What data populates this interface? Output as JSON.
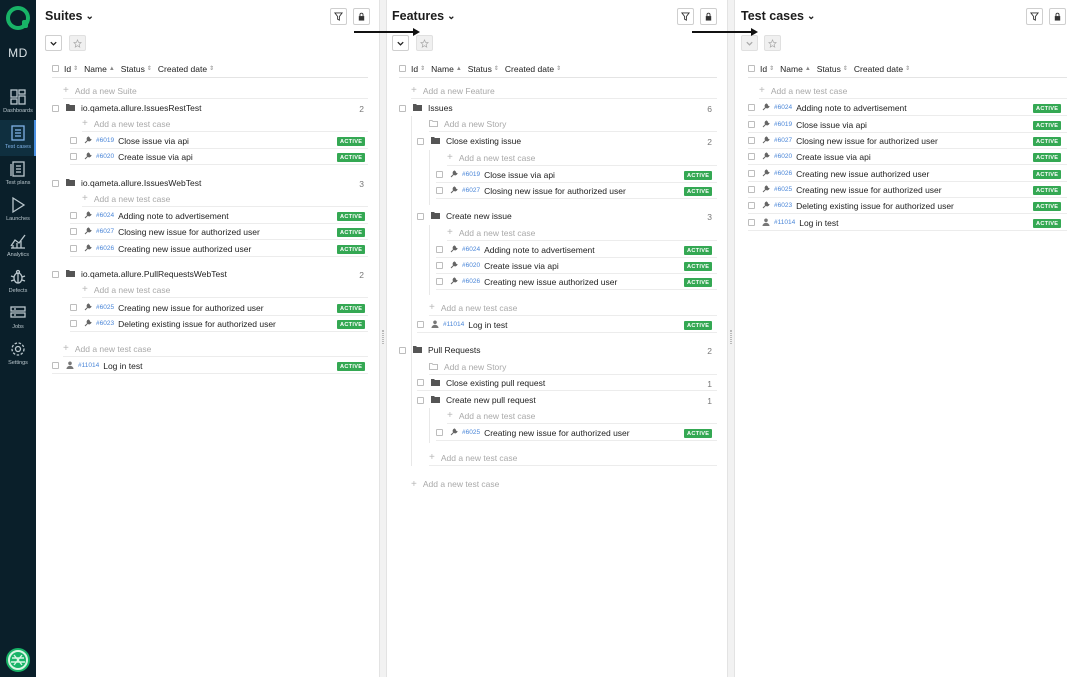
{
  "sidebar": {
    "user_initials": "MD",
    "items": [
      {
        "label": "Dashboards",
        "icon": "dashboard-icon"
      },
      {
        "label": "Test cases",
        "icon": "test-cases-icon"
      },
      {
        "label": "Test plans",
        "icon": "test-plans-icon"
      },
      {
        "label": "Launches",
        "icon": "launches-icon"
      },
      {
        "label": "Analytics",
        "icon": "analytics-icon"
      },
      {
        "label": "Defects",
        "icon": "defects-icon"
      },
      {
        "label": "Jobs",
        "icon": "jobs-icon"
      },
      {
        "label": "Settings",
        "icon": "settings-icon"
      }
    ]
  },
  "columns": {
    "id": "Id",
    "name": "Name",
    "status": "Status",
    "created": "Created date"
  },
  "status_active": "ACTIVE",
  "colors": {
    "sidebar_bg": "#0a1f2a",
    "accent": "#18b367",
    "badge": "#34a853",
    "link": "#4a86d8"
  },
  "suites": {
    "title": "Suites",
    "add_suite": "Add a new Suite",
    "add_test_case": "Add a new test case",
    "groups": [
      {
        "name": "io.qameta.allure.IssuesRestTest",
        "count": "2",
        "cases": [
          {
            "id": "#6019",
            "name": "Close issue via api"
          },
          {
            "id": "#6020",
            "name": "Create issue via api"
          }
        ]
      },
      {
        "name": "io.qameta.allure.IssuesWebTest",
        "count": "3",
        "cases": [
          {
            "id": "#6024",
            "name": "Adding note to advertisement"
          },
          {
            "id": "#6027",
            "name": "Closing new issue for authorized user"
          },
          {
            "id": "#6026",
            "name": "Creating new issue authorized user"
          }
        ]
      },
      {
        "name": "io.qameta.allure.PullRequestsWebTest",
        "count": "2",
        "cases": [
          {
            "id": "#6025",
            "name": "Creating new issue for authorized user"
          },
          {
            "id": "#6023",
            "name": "Deleting existing issue for authorized user"
          }
        ]
      }
    ],
    "bottom_add": "Add a new test case",
    "loose_case": {
      "id": "#11014",
      "name": "Log in test"
    }
  },
  "features": {
    "title": "Features",
    "add_feature": "Add a new Feature",
    "add_story": "Add a new Story",
    "add_test_case": "Add a new test case",
    "issues": {
      "name": "Issues",
      "count": "6"
    },
    "close_existing_issue": {
      "name": "Close existing issue",
      "count": "2",
      "cases": [
        {
          "id": "#6019",
          "name": "Close issue via api"
        },
        {
          "id": "#6027",
          "name": "Closing new issue for authorized user"
        }
      ]
    },
    "create_new_issue": {
      "name": "Create new issue",
      "count": "3",
      "cases": [
        {
          "id": "#6024",
          "name": "Adding note to advertisement"
        },
        {
          "id": "#6020",
          "name": "Create issue via api"
        },
        {
          "id": "#6026",
          "name": "Creating new issue authorized user"
        }
      ]
    },
    "issues_loose_case": {
      "id": "#11014",
      "name": "Log in test"
    },
    "pull_requests": {
      "name": "Pull Requests",
      "count": "2"
    },
    "close_existing_pr": {
      "name": "Close existing pull request",
      "count": "1"
    },
    "create_new_pr": {
      "name": "Create new pull request",
      "count": "1",
      "cases": [
        {
          "id": "#6025",
          "name": "Creating new issue for authorized user"
        }
      ]
    }
  },
  "testcases": {
    "title": "Test cases",
    "add_test_case": "Add a new test case",
    "cases": [
      {
        "id": "#6024",
        "name": "Adding note to advertisement",
        "icon": "wrench"
      },
      {
        "id": "#6019",
        "name": "Close issue via api",
        "icon": "wrench"
      },
      {
        "id": "#6027",
        "name": "Closing new issue for authorized user",
        "icon": "wrench"
      },
      {
        "id": "#6020",
        "name": "Create issue via api",
        "icon": "wrench"
      },
      {
        "id": "#6026",
        "name": "Creating new issue authorized user",
        "icon": "wrench"
      },
      {
        "id": "#6025",
        "name": "Creating new issue for authorized user",
        "icon": "wrench"
      },
      {
        "id": "#6023",
        "name": "Deleting existing issue for authorized user",
        "icon": "wrench"
      },
      {
        "id": "#11014",
        "name": "Log in test",
        "icon": "person"
      }
    ]
  }
}
